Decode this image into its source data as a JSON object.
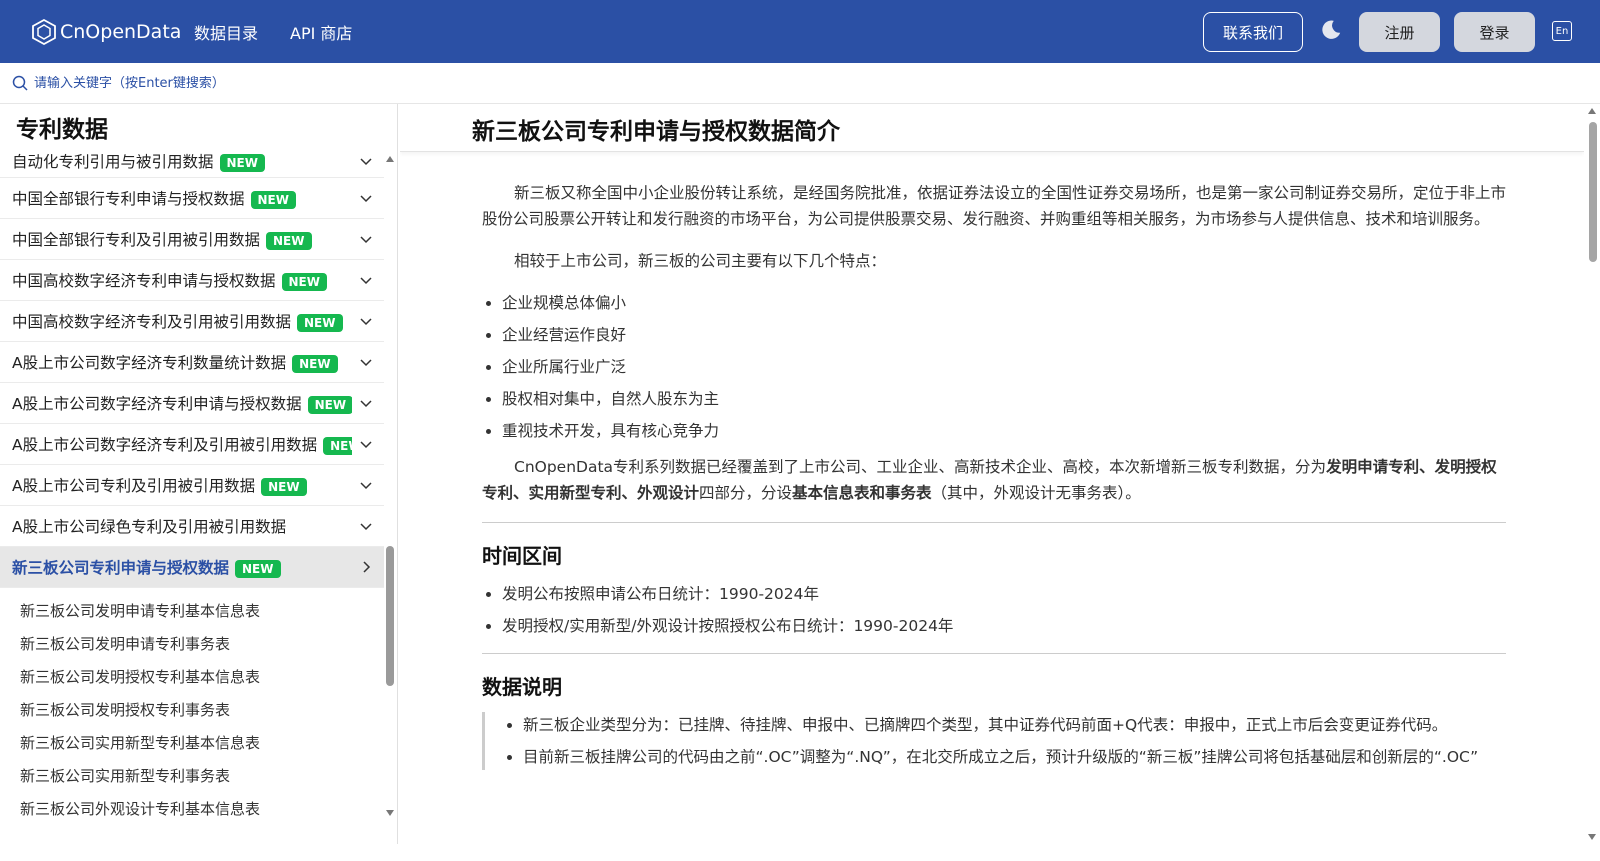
{
  "header": {
    "brand": "CnOpenData",
    "nav": [
      "数据目录",
      "API 商店"
    ],
    "contact": "联系我们",
    "register": "注册",
    "login": "登录",
    "lang": "En"
  },
  "search": {
    "placeholder": "请输入关键字（按Enter键搜索）"
  },
  "sidebar": {
    "title": "专利数据",
    "items": [
      {
        "label": "自动化专利引用与被引用数据",
        "badge": "NEW"
      },
      {
        "label": "中国全部银行专利申请与授权数据",
        "badge": "NEW"
      },
      {
        "label": "中国全部银行专利及引用被引用数据",
        "badge": "NEW"
      },
      {
        "label": "中国高校数字经济专利申请与授权数据",
        "badge": "NEW"
      },
      {
        "label": "中国高校数字经济专利及引用被引用数据",
        "badge": "NEW"
      },
      {
        "label": "A股上市公司数字经济专利数量统计数据",
        "badge": "NEW"
      },
      {
        "label": "A股上市公司数字经济专利申请与授权数据",
        "badge": "NEW"
      },
      {
        "label": "A股上市公司数字经济专利及引用被引用数据",
        "badge": "NEW"
      },
      {
        "label": "A股上市公司专利及引用被引用数据",
        "badge": "NEW"
      },
      {
        "label": "A股上市公司绿色专利及引用被引用数据",
        "badge": ""
      },
      {
        "label": "新三板公司专利申请与授权数据",
        "badge": "NEW"
      }
    ],
    "sub_items": [
      "新三板公司发明申请专利基本信息表",
      "新三板公司发明申请专利事务表",
      "新三板公司发明授权专利基本信息表",
      "新三板公司发明授权专利事务表",
      "新三板公司实用新型专利基本信息表",
      "新三板公司实用新型专利事务表",
      "新三板公司外观设计专利基本信息表"
    ]
  },
  "main": {
    "title": "新三板公司专利申请与授权数据简介",
    "intro": "新三板又称全国中小企业股份转让系统，是经国务院批准，依据证券法设立的全国性证券交易场所，也是第一家公司制证券交易所，定位于非上市股份公司股票公开转让和发行融资的市场平台，为公司提供股票交易、发行融资、并购重组等相关服务，为市场参与人提供信息、技术和培训服务。",
    "features_intro": "相较于上市公司，新三板的公司主要有以下几个特点：",
    "features": [
      "企业规模总体偏小",
      "企业经营运作良好",
      "企业所属行业广泛",
      "股权相对集中，自然人股东为主",
      "重视技术开发，具有核心竞争力"
    ],
    "coverage_1": "CnOpenData专利系列数据已经覆盖到了上市公司、工业企业、高新技术企业、高校，本次新增新三板专利数据，分为",
    "coverage_bold_1": "发明申请专利、发明授权专利、实用新型专利、外观设计",
    "coverage_2": "四部分，分设",
    "coverage_bold_2": "基本信息表和事务表",
    "coverage_3": "（其中，外观设计无事务表）。",
    "time_heading": "时间区间",
    "time_items": [
      "发明公布按照申请公布日统计：1990-2024年",
      "发明授权/实用新型/外观设计按照授权公布日统计：1990-2024年"
    ],
    "desc_heading": "数据说明",
    "desc_items": [
      "新三板企业类型分为：已挂牌、待挂牌、申报中、已摘牌四个类型，其中证券代码前面+Q代表：申报中，正式上市后会变更证券代码。",
      "目前新三板挂牌公司的代码由之前“.OC”调整为“.NQ”，在北交所成立之后，预计升级版的“新三板”挂牌公司将包括基础层和创新层的“.OC”"
    ]
  }
}
